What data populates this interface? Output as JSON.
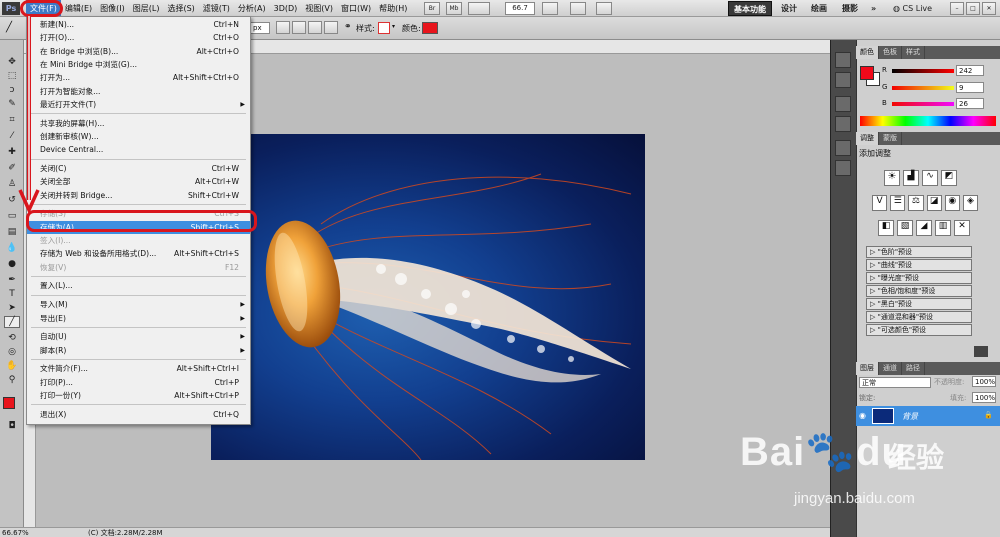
{
  "menubar": {
    "logo": "Ps",
    "items": [
      "文件(F)",
      "编辑(E)",
      "图像(I)",
      "图层(L)",
      "选择(S)",
      "滤镜(T)",
      "分析(A)",
      "3D(D)",
      "视图(V)",
      "窗口(W)",
      "帮助(H)"
    ],
    "buttons": [
      "Br",
      "Mb"
    ],
    "zoom": "66.7",
    "workspaces": [
      "基本功能",
      "设计",
      "绘画",
      "摄影"
    ],
    "more": "»",
    "cslive": "CS Live"
  },
  "options": {
    "units": "px",
    "style_label": "样式:",
    "color_label": "颜色:",
    "color": "#e8141c"
  },
  "file_menu": {
    "items": [
      {
        "label": "新建(N)...",
        "shortcut": "Ctrl+N",
        "state": "normal"
      },
      {
        "label": "打开(O)...",
        "shortcut": "Ctrl+O",
        "state": "normal"
      },
      {
        "label": "在 Bridge 中浏览(B)...",
        "shortcut": "Alt+Ctrl+O",
        "state": "normal"
      },
      {
        "label": "在 Mini Bridge 中浏览(G)...",
        "shortcut": "",
        "state": "normal"
      },
      {
        "label": "打开为...",
        "shortcut": "Alt+Shift+Ctrl+O",
        "state": "normal"
      },
      {
        "label": "打开为智能对象...",
        "shortcut": "",
        "state": "normal"
      },
      {
        "label": "最近打开文件(T)",
        "shortcut": "",
        "state": "submenu"
      },
      {
        "label": "共享我的屏幕(H)...",
        "shortcut": "",
        "state": "normal"
      },
      {
        "label": "创建新审核(W)...",
        "shortcut": "",
        "state": "normal"
      },
      {
        "label": "Device Central...",
        "shortcut": "",
        "state": "normal"
      },
      {
        "label": "关闭(C)",
        "shortcut": "Ctrl+W",
        "state": "normal"
      },
      {
        "label": "关闭全部",
        "shortcut": "Alt+Ctrl+W",
        "state": "normal"
      },
      {
        "label": "关闭并转到 Bridge...",
        "shortcut": "Shift+Ctrl+W",
        "state": "normal"
      },
      {
        "label": "存储(S)",
        "shortcut": "Ctrl+S",
        "state": "disabled"
      },
      {
        "label": "存储为(A)...",
        "shortcut": "Shift+Ctrl+S",
        "state": "highlighted"
      },
      {
        "label": "签入(I)...",
        "shortcut": "",
        "state": "disabled"
      },
      {
        "label": "存储为 Web 和设备所用格式(D)...",
        "shortcut": "Alt+Shift+Ctrl+S",
        "state": "normal"
      },
      {
        "label": "恢复(V)",
        "shortcut": "F12",
        "state": "disabled"
      },
      {
        "label": "置入(L)...",
        "shortcut": "",
        "state": "normal"
      },
      {
        "label": "导入(M)",
        "shortcut": "",
        "state": "submenu"
      },
      {
        "label": "导出(E)",
        "shortcut": "",
        "state": "submenu"
      },
      {
        "label": "自动(U)",
        "shortcut": "",
        "state": "submenu"
      },
      {
        "label": "脚本(R)",
        "shortcut": "",
        "state": "submenu"
      },
      {
        "label": "文件简介(F)...",
        "shortcut": "Alt+Shift+Ctrl+I",
        "state": "normal"
      },
      {
        "label": "打印(P)...",
        "shortcut": "Ctrl+P",
        "state": "normal"
      },
      {
        "label": "打印一份(Y)",
        "shortcut": "Alt+Shift+Ctrl+P",
        "state": "normal"
      },
      {
        "label": "退出(X)",
        "shortcut": "Ctrl+Q",
        "state": "normal"
      }
    ]
  },
  "color_panel": {
    "tabs": [
      "颜色",
      "色板",
      "样式"
    ],
    "r": "242",
    "g": "9",
    "b": "26",
    "r_label": "R",
    "g_label": "G",
    "b_label": "B",
    "swatch": "#f2091a"
  },
  "adjust_panel": {
    "tabs": [
      "调整",
      "蒙版"
    ],
    "title": "添加调整",
    "presets": [
      "\"色阶\"预设",
      "\"曲线\"预设",
      "\"曝光度\"预设",
      "\"色相/饱和度\"预设",
      "\"黑白\"预设",
      "\"通道混和器\"预设",
      "\"可选颜色\"预设"
    ]
  },
  "layers_panel": {
    "tabs": [
      "图层",
      "通道",
      "路径"
    ],
    "blend_mode": "正常",
    "opacity_label": "不透明度:",
    "opacity": "100%",
    "lock_label": "锁定:",
    "fill_label": "填充:",
    "fill": "100%",
    "layer_name": "背景"
  },
  "status": {
    "zoom": "66.67%",
    "doc": "(C) 文档:2.28M/2.28M"
  },
  "watermark": {
    "brand": "Bai",
    "brand2": "du",
    "cn": "经验",
    "url": "jingyan.baidu.com"
  }
}
